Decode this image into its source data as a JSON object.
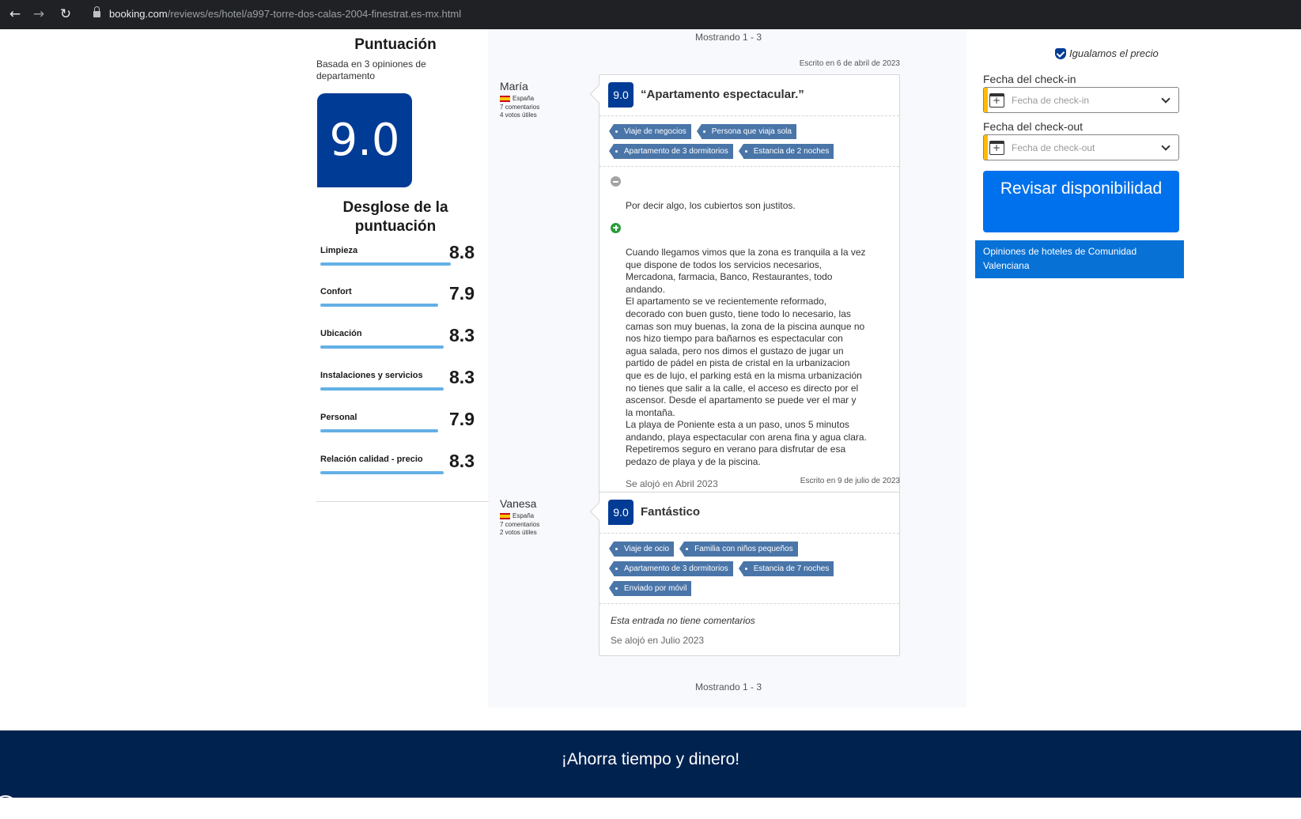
{
  "browser": {
    "url_domain": "booking.com",
    "url_path": "/reviews/es/hotel/a997-torre-dos-calas-2004-finestrat.es-mx.html"
  },
  "score_panel": {
    "title": "Puntuación",
    "subtitle": "Basada en 3 opiniones de departamento",
    "overall": "9.0",
    "breakdown_title": "Desglose de la puntuación",
    "categories": [
      {
        "label": "Limpieza",
        "value": "8.8",
        "score": 8.8
      },
      {
        "label": "Confort",
        "value": "7.9",
        "score": 7.9
      },
      {
        "label": "Ubicación",
        "value": "8.3",
        "score": 8.3
      },
      {
        "label": "Instalaciones y servicios",
        "value": "8.3",
        "score": 8.3
      },
      {
        "label": "Personal",
        "value": "7.9",
        "score": 7.9
      },
      {
        "label": "Relación calidad - precio",
        "value": "8.3",
        "score": 8.3
      }
    ]
  },
  "reviews": {
    "showing_top": "Mostrando 1 - 3",
    "showing_bottom": "Mostrando 1 - 3",
    "items": [
      {
        "written": "Escrito en 6 de abril de 2023",
        "name": "María",
        "country": "España",
        "comments": "7 comentarios",
        "votes": "4 votos útiles",
        "score": "9.0",
        "title": "“Apartamento espectacular.”",
        "tags": [
          "Viaje de negocios",
          "Persona que viaja sola",
          "Apartamento de 3 dormitorios",
          "Estancia de 2 noches"
        ],
        "negative": "Por decir algo, los cubiertos son justitos.",
        "positive": "Cuando llegamos vimos que la zona es tranquila a la vez\nque dispone de todos los servicios necesarios,\nMercadona, farmacia, Banco, Restaurantes, todo\nandando.\nEl apartamento se ve recientemente reformado,\ndecorado con buen gusto, tiene todo lo necesario, las\ncamas son muy buenas, la zona de la piscina aunque no\nnos hizo tiempo para bañarnos es espectacular con\nagua salada, pero nos dimos el gustazo de jugar un\npartido de pádel en pista de cristal en la urbanizacion\nque es de lujo, el parking está en la misma urbanización\nno tienes que salir a la calle, el acceso es directo por el\nascensor. Desde el apartamento  se puede ver el mar y\nla montaña.\nLa playa de Poniente esta a un paso, unos 5 minutos\nandando, playa espectacular con arena fina y agua clara.\nRepetiremos seguro en verano para disfrutar de esa\npedazo de playa y de la piscina.",
        "stayed": "Se alojó en Abril 2023"
      },
      {
        "written": "Escrito en 9 de julio de 2023",
        "name": "Vanesa",
        "country": "España",
        "comments": "7 comentarios",
        "votes": "2 votos útiles",
        "score": "9.0",
        "title": "Fantástico",
        "tags": [
          "Viaje de ocio",
          "Familia con niños pequeños",
          "Apartamento de 3 dormitorios",
          "Estancia de 7 noches",
          "Enviado por móvil"
        ],
        "no_comment": "Esta entrada no tiene comentarios",
        "stayed": "Se alojó en Julio 2023"
      }
    ]
  },
  "booking": {
    "price_match": "Igualamos el precio",
    "checkin_label": "Fecha del check-in",
    "checkin_placeholder": "Fecha de check-in",
    "checkout_label": "Fecha del check-out",
    "checkout_placeholder": "Fecha de check-out",
    "check_button": "Revisar disponibilidad",
    "region_link": "Opiniones de hoteles de Comunidad Valenciana"
  },
  "footer": {
    "title": "¡Ahorra tiempo y dinero!"
  },
  "colors": {
    "brand_dark": "#003b95",
    "action_blue": "#0071ec",
    "footer_bg": "#00224f",
    "bar_blue": "#63b0e6",
    "tag_blue": "#4a75a8"
  }
}
